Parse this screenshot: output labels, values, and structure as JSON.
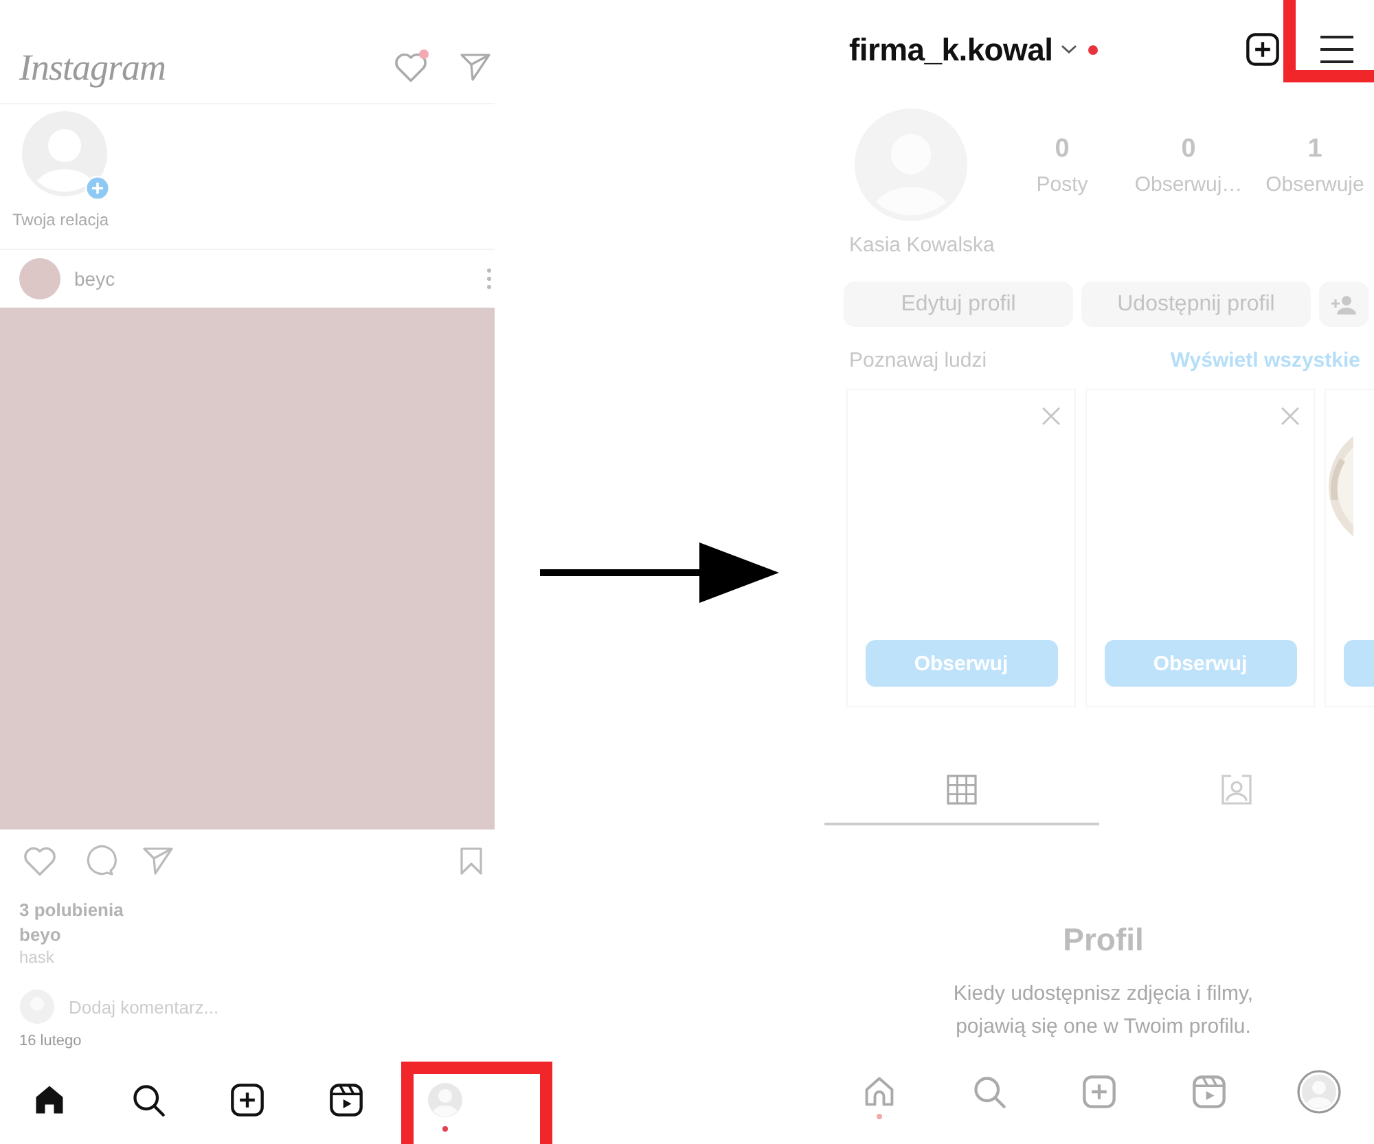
{
  "feed_screen": {
    "logo": "Instagram",
    "has_notification": true,
    "profile_highlighted": true,
    "story": {
      "label": "Twoja relacja"
    },
    "post": {
      "author": "beyc",
      "likes": "3 polubienia",
      "caption_author": "beyo",
      "caption_next_line": "hask",
      "comment_placeholder": "Dodaj komentarz...",
      "date": "16 lutego"
    },
    "nav": [
      {
        "kind": "home",
        "selected": true,
        "badge": false
      },
      {
        "kind": "search",
        "selected": false,
        "badge": false
      },
      {
        "kind": "create",
        "selected": false,
        "badge": false
      },
      {
        "kind": "reels",
        "selected": false,
        "badge": false
      },
      {
        "kind": "profile",
        "selected": false,
        "badge": true
      }
    ]
  },
  "profile_screen": {
    "username": "firma_k.kowal",
    "has_notification": true,
    "menu_highlighted": true,
    "stats": [
      {
        "value": "0",
        "label": "Posty"
      },
      {
        "value": "0",
        "label": "Obserwuj…"
      },
      {
        "value": "1",
        "label": "Obserwuje"
      }
    ],
    "name": "Kasia Kowalska",
    "buttons": [
      "Edytuj profil",
      "Udostępnij profil"
    ],
    "suggestions": {
      "title": "Poznawaj ludzi",
      "link": "Wyświetl wszystkie",
      "cards": [
        {
          "button": "Obserwuj",
          "dismissible": true,
          "picture": false
        },
        {
          "button": "Obserwuj",
          "dismissible": true,
          "picture": false
        },
        {
          "dismissible": false,
          "picture": true
        }
      ]
    },
    "tabs": [
      {
        "kind": "grid",
        "selected": true
      },
      {
        "kind": "tagged",
        "selected": false
      }
    ],
    "empty": {
      "title": "Profil",
      "lines": [
        "Kiedy udostępnisz zdjęcia i filmy,",
        "pojawią się one w Twoim profilu."
      ]
    },
    "nav": [
      {
        "kind": "home",
        "selected": false,
        "badge": true
      },
      {
        "kind": "search",
        "selected": false,
        "badge": false
      },
      {
        "kind": "create",
        "selected": false,
        "badge": false
      },
      {
        "kind": "reels",
        "selected": false,
        "badge": false
      },
      {
        "kind": "profile",
        "selected": true,
        "badge": false
      }
    ]
  }
}
